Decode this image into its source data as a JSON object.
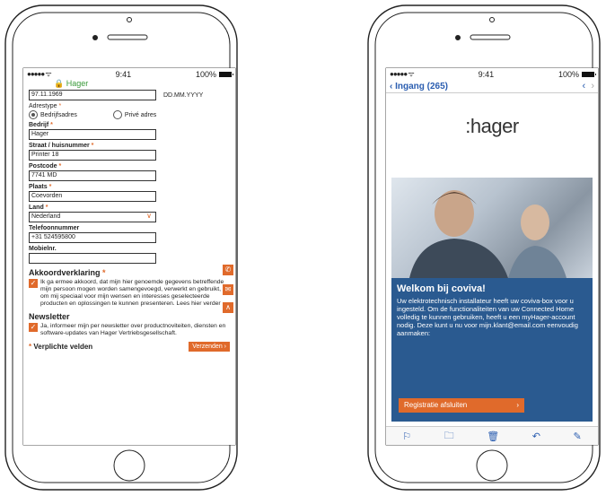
{
  "status_bar": {
    "signal": "●●●●● ᯤ",
    "time": "9:41",
    "battery": "100%"
  },
  "left": {
    "url": "🔒 Hager",
    "birthdate": {
      "value": "97.11.1969",
      "format_hint": "DD.MM.YYYY"
    },
    "address_type": {
      "label": "Adrestype",
      "options": [
        {
          "label": "Bedrijfsadres",
          "selected": true
        },
        {
          "label": "Privé adres",
          "selected": false
        }
      ]
    },
    "fields": [
      {
        "label": "Bedrijf",
        "required": true,
        "value": "Hager"
      },
      {
        "label": "Straat / huisnummer",
        "required": true,
        "value": "Printer 18"
      },
      {
        "label": "Postcode",
        "required": true,
        "value": "7741 MD"
      },
      {
        "label": "Plaats",
        "required": true,
        "value": "Coevorden"
      },
      {
        "label": "Land",
        "required": true,
        "value": "Nederland"
      }
    ],
    "phone": {
      "label": "Telefoonnummer",
      "value": "+31 524595800"
    },
    "mobile": {
      "label": "Mobielnr.",
      "value": ""
    },
    "agreement": {
      "title": "Akkoordverklaring",
      "text": "Ik ga ermee akkoord, dat mijn hier genoemde gegevens betreffende mijn persoon mogen worden samengevoegd, verwerkt en gebruikt, om mij speciaal voor mijn wensen en interesses geselecteerde producten en oplossingen te kunnen presenteren. Lees hier verder"
    },
    "newsletter": {
      "title": "Newsletter",
      "text": "Ja, informeer mijn per newsletter over productnoviteiten, diensten en software-updates van Hager Vertriebsgesellschaft."
    },
    "required_note": "Verplichte velden",
    "submit_label": "Verzenden"
  },
  "right": {
    "back_label": "Ingang (265)",
    "logo": ":hager",
    "heading": "Welkom bij coviva!",
    "body": "Uw elektrotechnisch installateur heeft uw coviva-box voor u ingesteld. Om de functionaliteiten van uw Connected Home volledig te kunnen gebruiken, heeft u een myHager-account nodig. Deze kunt u nu voor mijn.klant@email.com eenvoudig aanmaken:",
    "cta_label": "Registratie afsluiten",
    "toolbar_icons": [
      "flag-icon",
      "folder-icon",
      "trash-icon",
      "reply-icon",
      "compose-icon"
    ]
  },
  "colors": {
    "accent": "#e06a2b",
    "blue": "#2a5a90",
    "link": "#2a5db0",
    "green": "#3a9a3a"
  }
}
